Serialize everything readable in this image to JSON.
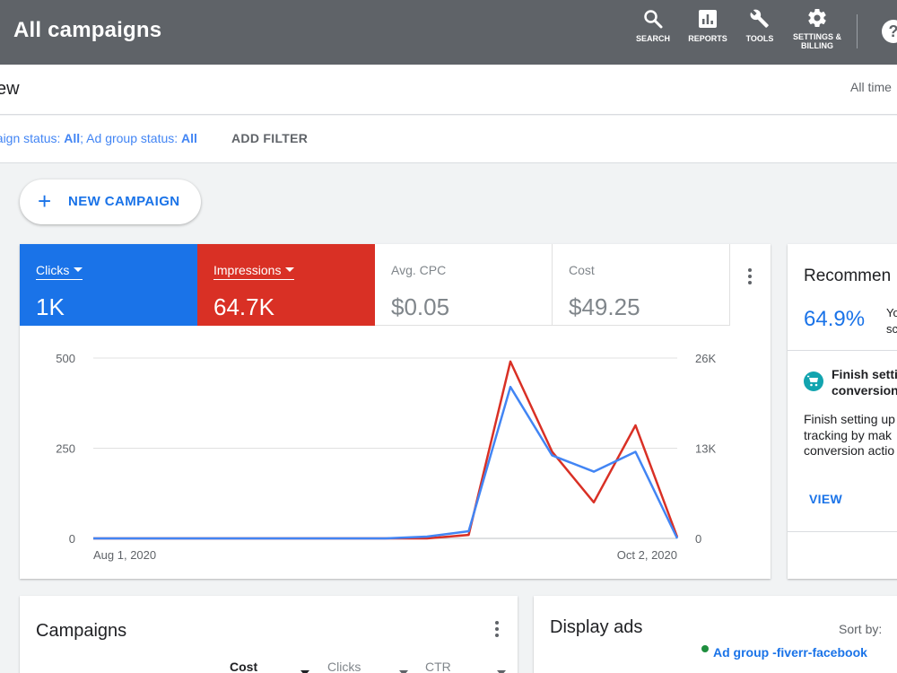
{
  "topbar": {
    "title": "All campaigns",
    "tools": [
      {
        "label": "SEARCH",
        "icon": "search-icon"
      },
      {
        "label": "REPORTS",
        "icon": "reports-icon"
      },
      {
        "label": "TOOLS",
        "icon": "wrench-icon"
      },
      {
        "label_line1": "SETTINGS &",
        "label_line2": "BILLING",
        "icon": "gear-icon"
      }
    ],
    "help": "?"
  },
  "subheader": {
    "title": "ew",
    "date_range": "All time"
  },
  "filters": {
    "prefix": "paign status: ",
    "campaign_status": "All",
    "middle": "; Ad group status: ",
    "ad_group_status": "All",
    "add_filter": "ADD FILTER"
  },
  "new_campaign": {
    "label": "NEW CAMPAIGN"
  },
  "metrics": [
    {
      "label": "Clicks",
      "value": "1K",
      "color": "#1a73e8",
      "selected": true
    },
    {
      "label": "Impressions",
      "value": "64.7K",
      "color": "#d93025",
      "selected": true
    },
    {
      "label": "Avg. CPC",
      "value": "$0.05",
      "selected": false
    },
    {
      "label": "Cost",
      "value": "$49.25",
      "selected": false
    }
  ],
  "chart_data": {
    "type": "line",
    "x_start": "Aug 1, 2020",
    "x_end": "Oct 2, 2020",
    "x_ticks": [
      "Aug 1, 2020",
      "Oct 2, 2020"
    ],
    "y_left": {
      "ticks": [
        "500",
        "250",
        "0"
      ],
      "range": [
        0,
        500
      ],
      "series": "Clicks"
    },
    "y_right": {
      "ticks": [
        "26K",
        "13K",
        "0"
      ],
      "range": [
        0,
        26000
      ],
      "series": "Impressions"
    },
    "grid": true,
    "series": [
      {
        "name": "Clicks",
        "color": "#4285f4",
        "axis": "left",
        "x": [
          0,
          1,
          2,
          3,
          4,
          5,
          6,
          7,
          8,
          9,
          10,
          11,
          12,
          13,
          14
        ],
        "values": [
          0,
          0,
          0,
          0,
          0,
          0,
          0,
          0,
          5,
          20,
          420,
          230,
          185,
          240,
          0
        ]
      },
      {
        "name": "Impressions",
        "color": "#d93025",
        "axis": "right",
        "x": [
          0,
          1,
          2,
          3,
          4,
          5,
          6,
          7,
          8,
          9,
          10,
          11,
          12,
          13,
          14
        ],
        "values": [
          0,
          0,
          0,
          0,
          0,
          0,
          0,
          0,
          0,
          500,
          25500,
          12500,
          5200,
          16300,
          200
        ]
      }
    ]
  },
  "recommendations": {
    "title": "Recommen",
    "score": "64.9%",
    "side_text_1": "Yo",
    "side_text_2": "sc",
    "item_title_1": "Finish setti",
    "item_title_2": "conversion",
    "body_1": "Finish setting up",
    "body_2": "tracking by mak",
    "body_3": "conversion actio",
    "view": "VIEW"
  },
  "campaigns_card": {
    "title": "Campaigns",
    "columns": [
      "Cost",
      "Clicks",
      "CTR"
    ]
  },
  "display_ads_card": {
    "title": "Display ads",
    "sort_by": "Sort by:",
    "ad_group": "Ad group -fiverr-facebook",
    "ad_group_dot_color": "#1e8e3e"
  }
}
